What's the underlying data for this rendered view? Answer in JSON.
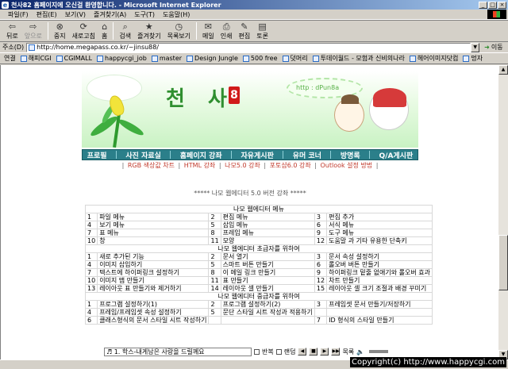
{
  "window": {
    "title": "천사82 홈페이지에 오신걸 환영합니다. - Microsoft Internet Explorer",
    "minimize": "_",
    "maximize": "□",
    "close": "×"
  },
  "menu": [
    "파일(F)",
    "편집(E)",
    "보기(V)",
    "즐겨찾기(A)",
    "도구(T)",
    "도움말(H)"
  ],
  "toolbar": {
    "back": "뒤로",
    "forward": "앞으로",
    "stop": "중지",
    "refresh": "새로고침",
    "home": "홈",
    "search": "검색",
    "favorites": "즐겨찾기",
    "history": "목록보기",
    "mail": "메일",
    "print": "인쇄",
    "edit": "편집",
    "discuss": "토론"
  },
  "address": {
    "label": "주소(D)",
    "url": "http://home.megapass.co.kr/~jinsu88/",
    "go": "이동"
  },
  "links": {
    "label": "연결",
    "items": [
      "해피CGI",
      "CGIMALL",
      "happycgi_job",
      "master",
      "Design Jungle",
      "500 free",
      "덧머리",
      "투데이월드 - 모험과 신비의나라",
      "헤어이미지닷컴",
      "멍자"
    ]
  },
  "banner": {
    "site_name": "천 사",
    "site_tag": "8",
    "url_bubble": "http : dPun8a"
  },
  "nav": [
    "프로필",
    "사진 자료실",
    "홈페이지 강좌",
    "자유게시판",
    "유머 코너",
    "방명록",
    "Q/A게시판"
  ],
  "sublinks": [
    "RGB 색상값 차트",
    "HTML 강좌",
    "나모5.0 강좌",
    "포토샵6.0 강좌",
    "Outlook 설정 방법"
  ],
  "edition_note": "***** 나모 웹에디터 5.0 버전 강좌 *****",
  "menu_table": {
    "sections": [
      {
        "title": "나모 웹에디터 메뉴",
        "rows": [
          [
            "1",
            "파일 메뉴",
            "2",
            "편집 메뉴",
            "3",
            "편집 추가"
          ],
          [
            "4",
            "보기 메뉴",
            "5",
            "삽입 메뉴",
            "6",
            "서식 메뉴"
          ],
          [
            "7",
            "표 메뉴",
            "8",
            "프레임 메뉴",
            "9",
            "도구 메뉴"
          ],
          [
            "10",
            "창",
            "11",
            "모양",
            "12",
            "도움말 과 기타 유용한 단축키"
          ]
        ]
      },
      {
        "title": "나모 웹에디터 초급자를 위하여",
        "rows": [
          [
            "1",
            "새로 추가된 기능",
            "2",
            "문서 열기",
            "3",
            "문서 속성 설정하기"
          ],
          [
            "4",
            "이미지 삽입하기",
            "5",
            "스마트 버튼 만들기",
            "6",
            "롤오버 버튼 만들기"
          ],
          [
            "7",
            "텍스트에 하이퍼링크 설정하기",
            "8",
            "이 메일 링크 만들기",
            "9",
            "하이퍼링크 밑줄 없애기와 롤오버 효과"
          ],
          [
            "10",
            "이미지 맵 만들기",
            "11",
            "표 만들기",
            "12",
            "차트 만들기"
          ],
          [
            "13",
            "레이아웃 표 만들기와 제거하기",
            "14",
            "레이아웃 셀 만들기",
            "15",
            "레이아웃 셀 크기 조절과 배경 꾸미기"
          ]
        ]
      },
      {
        "title": "나모 웹에디터 중급자를 위하여",
        "rows": [
          [
            "1",
            "프로그램 설정하기(1)",
            "2",
            "프로그램 설정하기(2)",
            "3",
            "프레임셋 문서 만들기/저장하기"
          ],
          [
            "4",
            "프레임/프레임셋 속성 설정하기",
            "5",
            "문단 스타일 시트 작성과 적용하기",
            "",
            ""
          ],
          [
            "6",
            "클래스형식의 문서 스타일 시트 작성하기",
            "",
            "",
            "7",
            "ID 형식의 스타일 만들기"
          ]
        ]
      }
    ]
  },
  "player": {
    "song": "♬ 1. 학스-내게남은 사랑을 드릴께요",
    "repeat": "반복",
    "random": "랜덤",
    "list": "목록"
  },
  "watermark": "Copyright(c) http://www.happycgi.com"
}
